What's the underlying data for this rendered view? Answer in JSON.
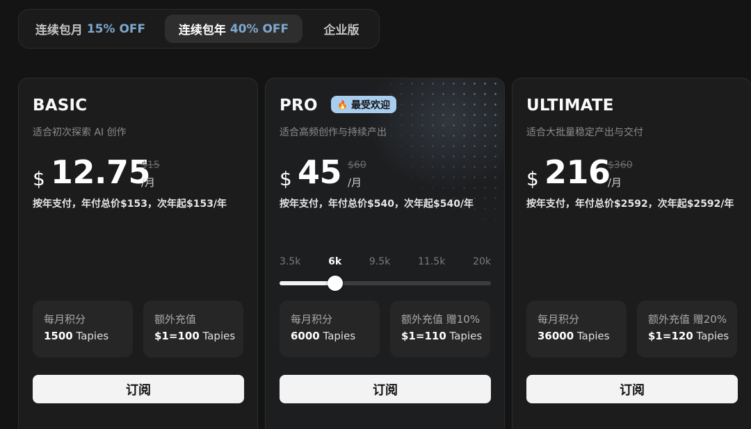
{
  "billing_tabs": [
    {
      "label": "连续包月",
      "discount": "15% OFF"
    },
    {
      "label": "连续包年",
      "discount": "40% OFF"
    },
    {
      "label": "企业版",
      "discount": ""
    }
  ],
  "active_tab": "连续包年",
  "plans": [
    {
      "name": "BASIC",
      "description": "适合初次探索 AI 创作",
      "currency": "$",
      "price": "12.75",
      "original_price": "$15",
      "unit": "/月",
      "billing_note": "按年支付，年付总价$153，次年起$153/年",
      "credits_title": "每月积分",
      "credits_amount": "1500",
      "credits_unit": "Tapies",
      "topup_title": "额外充值",
      "topup_rate": "$1=100",
      "topup_unit": "Tapies",
      "cta": "订阅"
    },
    {
      "name": "PRO",
      "badge": "最受欢迎",
      "badge_icon": "fire-icon",
      "description": "适合高频创作与持续产出",
      "currency": "$",
      "price": "45",
      "original_price": "$60",
      "unit": "/月",
      "billing_note": "按年支付，年付总价$540，次年起$540/年",
      "slider": {
        "ticks": [
          "3.5k",
          "6k",
          "9.5k",
          "11.5k",
          "20k"
        ],
        "selected": "6k",
        "selected_index": 1
      },
      "credits_title": "每月积分",
      "credits_amount": "6000",
      "credits_unit": "Tapies",
      "topup_title": "额外充值 赠10%",
      "topup_rate": "$1=110",
      "topup_unit": "Tapies",
      "cta": "订阅"
    },
    {
      "name": "ULTIMATE",
      "description": "适合大批量稳定产出与交付",
      "currency": "$",
      "price": "216",
      "original_price": "$360",
      "unit": "/月",
      "billing_note": "按年支付，年付总价$2592，次年起$2592/年",
      "credits_title": "每月积分",
      "credits_amount": "36000",
      "credits_unit": "Tapies",
      "topup_title": "额外充值 赠20%",
      "topup_rate": "$1=120",
      "topup_unit": "Tapies",
      "cta": "订阅"
    }
  ],
  "colors": {
    "background": "#141414",
    "card": "#1c1c1c",
    "discount": "#7fa8cf",
    "badge": "#a9cdee",
    "button": "#f3f3f3"
  }
}
